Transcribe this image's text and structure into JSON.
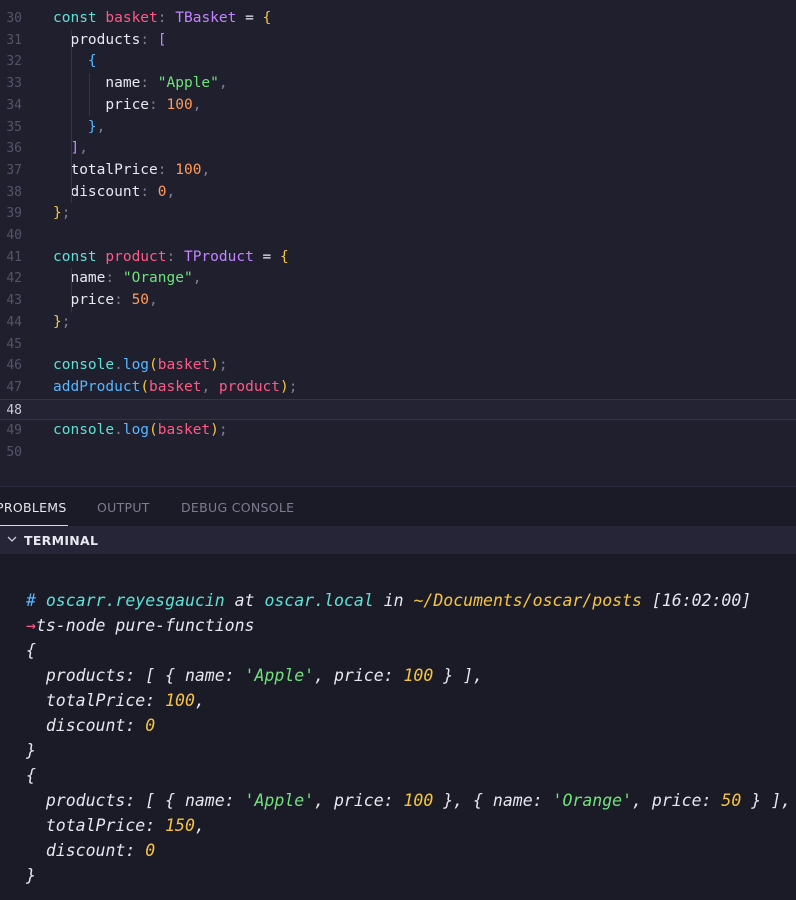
{
  "editor": {
    "lines": [
      {
        "n": "30",
        "tokens": [
          [
            "kw",
            "const "
          ],
          [
            "var",
            "basket"
          ],
          [
            "punc",
            ": "
          ],
          [
            "type",
            "TBasket"
          ],
          [
            "prop",
            " = "
          ],
          [
            "brace",
            "{"
          ]
        ]
      },
      {
        "n": "31",
        "tokens": [
          [
            "prop",
            "  products"
          ],
          [
            "punc",
            ": "
          ],
          [
            "brk",
            "["
          ]
        ]
      },
      {
        "n": "32",
        "tokens": [
          [
            "brk2",
            "    {"
          ]
        ]
      },
      {
        "n": "33",
        "tokens": [
          [
            "prop",
            "      name"
          ],
          [
            "punc",
            ": "
          ],
          [
            "str",
            "\"Apple\""
          ],
          [
            "punc",
            ","
          ]
        ]
      },
      {
        "n": "34",
        "tokens": [
          [
            "prop",
            "      price"
          ],
          [
            "punc",
            ": "
          ],
          [
            "num",
            "100"
          ],
          [
            "punc",
            ","
          ]
        ]
      },
      {
        "n": "35",
        "tokens": [
          [
            "brk2",
            "    }"
          ],
          [
            "punc",
            ","
          ]
        ]
      },
      {
        "n": "36",
        "tokens": [
          [
            "brk",
            "  ]"
          ],
          [
            "punc",
            ","
          ]
        ]
      },
      {
        "n": "37",
        "tokens": [
          [
            "prop",
            "  totalPrice"
          ],
          [
            "punc",
            ": "
          ],
          [
            "num",
            "100"
          ],
          [
            "punc",
            ","
          ]
        ]
      },
      {
        "n": "38",
        "tokens": [
          [
            "prop",
            "  discount"
          ],
          [
            "punc",
            ": "
          ],
          [
            "num",
            "0"
          ],
          [
            "punc",
            ","
          ]
        ]
      },
      {
        "n": "39",
        "tokens": [
          [
            "brace",
            "}"
          ],
          [
            "punc",
            ";"
          ]
        ]
      },
      {
        "n": "40",
        "tokens": []
      },
      {
        "n": "41",
        "tokens": [
          [
            "kw",
            "const "
          ],
          [
            "var",
            "product"
          ],
          [
            "punc",
            ": "
          ],
          [
            "type",
            "TProduct"
          ],
          [
            "prop",
            " = "
          ],
          [
            "brace",
            "{"
          ]
        ]
      },
      {
        "n": "42",
        "tokens": [
          [
            "prop",
            "  name"
          ],
          [
            "punc",
            ": "
          ],
          [
            "str",
            "\"Orange\""
          ],
          [
            "punc",
            ","
          ]
        ]
      },
      {
        "n": "43",
        "tokens": [
          [
            "prop",
            "  price"
          ],
          [
            "punc",
            ": "
          ],
          [
            "num",
            "50"
          ],
          [
            "punc",
            ","
          ]
        ]
      },
      {
        "n": "44",
        "tokens": [
          [
            "brace",
            "}"
          ],
          [
            "punc",
            ";"
          ]
        ]
      },
      {
        "n": "45",
        "tokens": []
      },
      {
        "n": "46",
        "tokens": [
          [
            "kw",
            "console"
          ],
          [
            "punc",
            "."
          ],
          [
            "fn",
            "log"
          ],
          [
            "brace",
            "("
          ],
          [
            "var",
            "basket"
          ],
          [
            "brace",
            ")"
          ],
          [
            "punc",
            ";"
          ]
        ]
      },
      {
        "n": "47",
        "tokens": [
          [
            "fn",
            "addProduct"
          ],
          [
            "brace",
            "("
          ],
          [
            "var",
            "basket"
          ],
          [
            "punc",
            ", "
          ],
          [
            "var",
            "product"
          ],
          [
            "brace",
            ")"
          ],
          [
            "punc",
            ";"
          ]
        ]
      },
      {
        "n": "48",
        "tokens": [],
        "current": true
      },
      {
        "n": "49",
        "tokens": [
          [
            "kw",
            "console"
          ],
          [
            "punc",
            "."
          ],
          [
            "fn",
            "log"
          ],
          [
            "brace",
            "("
          ],
          [
            "var",
            "basket"
          ],
          [
            "brace",
            ")"
          ],
          [
            "punc",
            ";"
          ]
        ]
      },
      {
        "n": "50",
        "tokens": []
      }
    ]
  },
  "panel": {
    "tabs": [
      {
        "label": "PROBLEMS",
        "active": true
      },
      {
        "label": "OUTPUT",
        "active": false
      },
      {
        "label": "DEBUG CONSOLE",
        "active": false
      }
    ],
    "terminal_title": "TERMINAL"
  },
  "terminal": {
    "lines": [
      [
        [
          "t-hash",
          "# "
        ],
        [
          "t-user",
          "oscarr.reyesgaucin"
        ],
        [
          "t-at",
          " at "
        ],
        [
          "t-user",
          "oscar.local"
        ],
        [
          "t-at",
          " in "
        ],
        [
          "t-path",
          "~/Documents/oscar/posts"
        ],
        [
          "t-time",
          " [16:02:00]"
        ]
      ],
      [
        [
          "t-arrow",
          "→"
        ],
        [
          "t-at",
          "ts-node pure-functions"
        ]
      ],
      [
        [
          "t-at",
          "{"
        ]
      ],
      [
        [
          "t-at",
          "  products: [ { name: "
        ],
        [
          "t-str",
          "'Apple'"
        ],
        [
          "t-at",
          ", price: "
        ],
        [
          "t-num",
          "100"
        ],
        [
          "t-at",
          " } ],"
        ]
      ],
      [
        [
          "t-at",
          "  totalPrice: "
        ],
        [
          "t-num",
          "100"
        ],
        [
          "t-at",
          ","
        ]
      ],
      [
        [
          "t-at",
          "  discount: "
        ],
        [
          "t-num",
          "0"
        ]
      ],
      [
        [
          "t-at",
          "}"
        ]
      ],
      [
        [
          "t-at",
          "{"
        ]
      ],
      [
        [
          "t-at",
          "  products: [ { name: "
        ],
        [
          "t-str",
          "'Apple'"
        ],
        [
          "t-at",
          ", price: "
        ],
        [
          "t-num",
          "100"
        ],
        [
          "t-at",
          " }, { name: "
        ],
        [
          "t-str",
          "'Orange'"
        ],
        [
          "t-at",
          ", price: "
        ],
        [
          "t-num",
          "50"
        ],
        [
          "t-at",
          " } ],"
        ]
      ],
      [
        [
          "t-at",
          "  totalPrice: "
        ],
        [
          "t-num",
          "150"
        ],
        [
          "t-at",
          ","
        ]
      ],
      [
        [
          "t-at",
          "  discount: "
        ],
        [
          "t-num",
          "0"
        ]
      ],
      [
        [
          "t-at",
          "}"
        ]
      ]
    ]
  }
}
